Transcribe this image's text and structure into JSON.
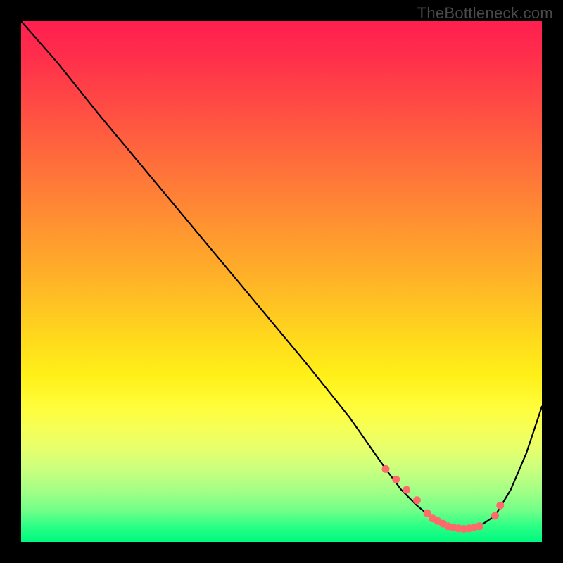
{
  "watermark": "TheBottleneck.com",
  "chart_data": {
    "type": "line",
    "title": "",
    "xlabel": "",
    "ylabel": "",
    "xlim": [
      0,
      100
    ],
    "ylim": [
      0,
      100
    ],
    "grid": false,
    "legend": false,
    "series": [
      {
        "name": "curve",
        "x": [
          0,
          7,
          15,
          25,
          35,
          45,
          55,
          63,
          70,
          73,
          76,
          79,
          82,
          85,
          88,
          91,
          94,
          97,
          100
        ],
        "values": [
          100,
          92,
          82,
          70,
          58,
          46,
          34,
          24,
          14,
          10,
          7,
          4.5,
          3,
          2.5,
          3,
          5,
          10,
          17,
          26
        ]
      }
    ],
    "marker_points": {
      "x": [
        70,
        72,
        74,
        76,
        78,
        79,
        80,
        81,
        82,
        83,
        84,
        85,
        86,
        87,
        88,
        91,
        92
      ],
      "values": [
        14,
        12,
        10,
        8,
        5.5,
        4.5,
        4,
        3.5,
        3,
        2.8,
        2.6,
        2.5,
        2.6,
        2.8,
        3,
        5,
        7
      ]
    }
  }
}
